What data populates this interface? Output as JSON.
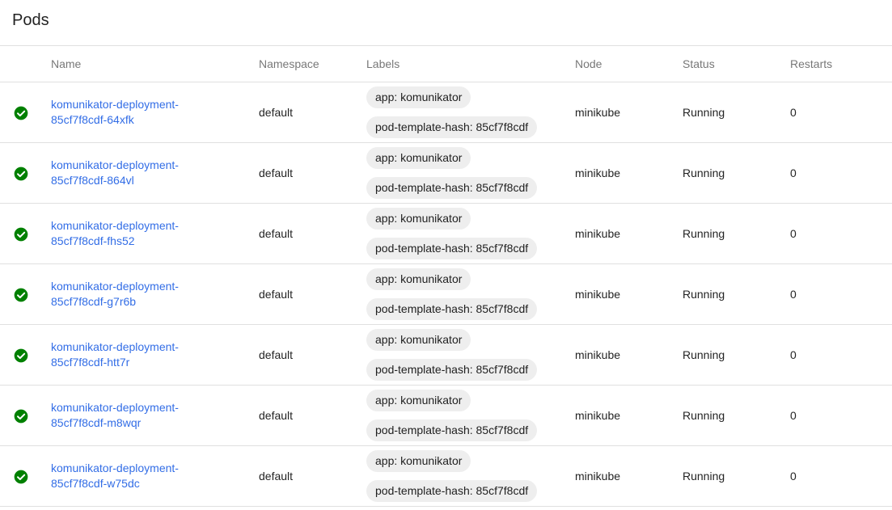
{
  "page": {
    "title": "Pods"
  },
  "table": {
    "columns": [
      "",
      "Name",
      "Namespace",
      "Labels",
      "Node",
      "Status",
      "Restarts"
    ],
    "rows": [
      {
        "status_icon": "check-circle-icon",
        "name_line1": "komunikator-deployment-",
        "name_line2": "85cf7f8cdf-64xfk",
        "namespace": "default",
        "labels": [
          "app: komunikator",
          "pod-template-hash: 85cf7f8cdf"
        ],
        "node": "minikube",
        "status": "Running",
        "restarts": "0"
      },
      {
        "status_icon": "check-circle-icon",
        "name_line1": "komunikator-deployment-",
        "name_line2": "85cf7f8cdf-864vl",
        "namespace": "default",
        "labels": [
          "app: komunikator",
          "pod-template-hash: 85cf7f8cdf"
        ],
        "node": "minikube",
        "status": "Running",
        "restarts": "0"
      },
      {
        "status_icon": "check-circle-icon",
        "name_line1": "komunikator-deployment-",
        "name_line2": "85cf7f8cdf-fhs52",
        "namespace": "default",
        "labels": [
          "app: komunikator",
          "pod-template-hash: 85cf7f8cdf"
        ],
        "node": "minikube",
        "status": "Running",
        "restarts": "0"
      },
      {
        "status_icon": "check-circle-icon",
        "name_line1": "komunikator-deployment-",
        "name_line2": "85cf7f8cdf-g7r6b",
        "namespace": "default",
        "labels": [
          "app: komunikator",
          "pod-template-hash: 85cf7f8cdf"
        ],
        "node": "minikube",
        "status": "Running",
        "restarts": "0"
      },
      {
        "status_icon": "check-circle-icon",
        "name_line1": "komunikator-deployment-",
        "name_line2": "85cf7f8cdf-htt7r",
        "namespace": "default",
        "labels": [
          "app: komunikator",
          "pod-template-hash: 85cf7f8cdf"
        ],
        "node": "minikube",
        "status": "Running",
        "restarts": "0"
      },
      {
        "status_icon": "check-circle-icon",
        "name_line1": "komunikator-deployment-",
        "name_line2": "85cf7f8cdf-m8wqr",
        "namespace": "default",
        "labels": [
          "app: komunikator",
          "pod-template-hash: 85cf7f8cdf"
        ],
        "node": "minikube",
        "status": "Running",
        "restarts": "0"
      },
      {
        "status_icon": "check-circle-icon",
        "name_line1": "komunikator-deployment-",
        "name_line2": "85cf7f8cdf-w75dc",
        "namespace": "default",
        "labels": [
          "app: komunikator",
          "pod-template-hash: 85cf7f8cdf"
        ],
        "node": "minikube",
        "status": "Running",
        "restarts": "0"
      }
    ]
  },
  "colors": {
    "link": "#326de6",
    "status_ok": "#008000",
    "chip_bg": "#eeeeee",
    "divider": "#e0e0e0"
  }
}
